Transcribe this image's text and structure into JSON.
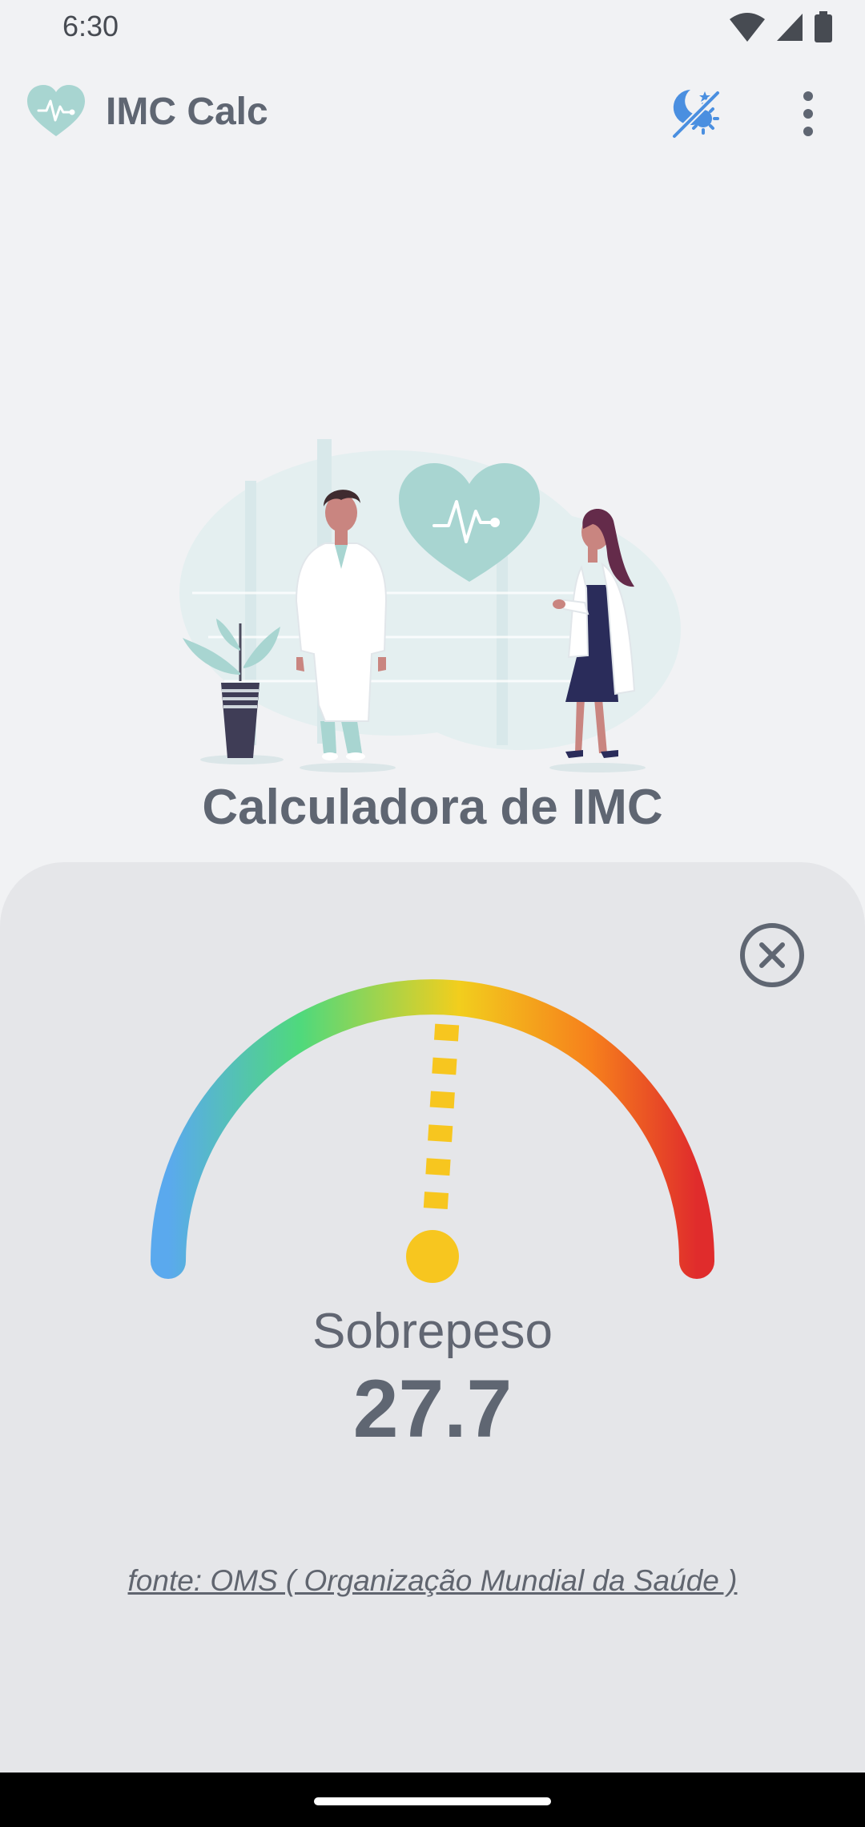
{
  "status_bar": {
    "time": "6:30"
  },
  "app_bar": {
    "title": "IMC Calc",
    "logo_icon": "heart-pulse-icon",
    "theme_icon": "night-day-toggle-icon",
    "menu_icon": "more-vertical-icon"
  },
  "main": {
    "heading": "Calculadora de IMC"
  },
  "result": {
    "category": "Sobrepeso",
    "value": "27.7",
    "gauge_level": 0.52,
    "source": "fonte: OMS ( Organização Mundial da Saúde )",
    "close_icon": "close-circle-icon"
  },
  "colors": {
    "accent_teal": "#a8d5d1",
    "indicator_yellow": "#f7c61f",
    "theme_icon_blue": "#4a8fe0",
    "gauge_start": "#5aa9ee",
    "gauge_green": "#4fd97c",
    "gauge_yellow": "#f2ce1d",
    "gauge_orange": "#f6801c",
    "gauge_end": "#e02c2c"
  }
}
